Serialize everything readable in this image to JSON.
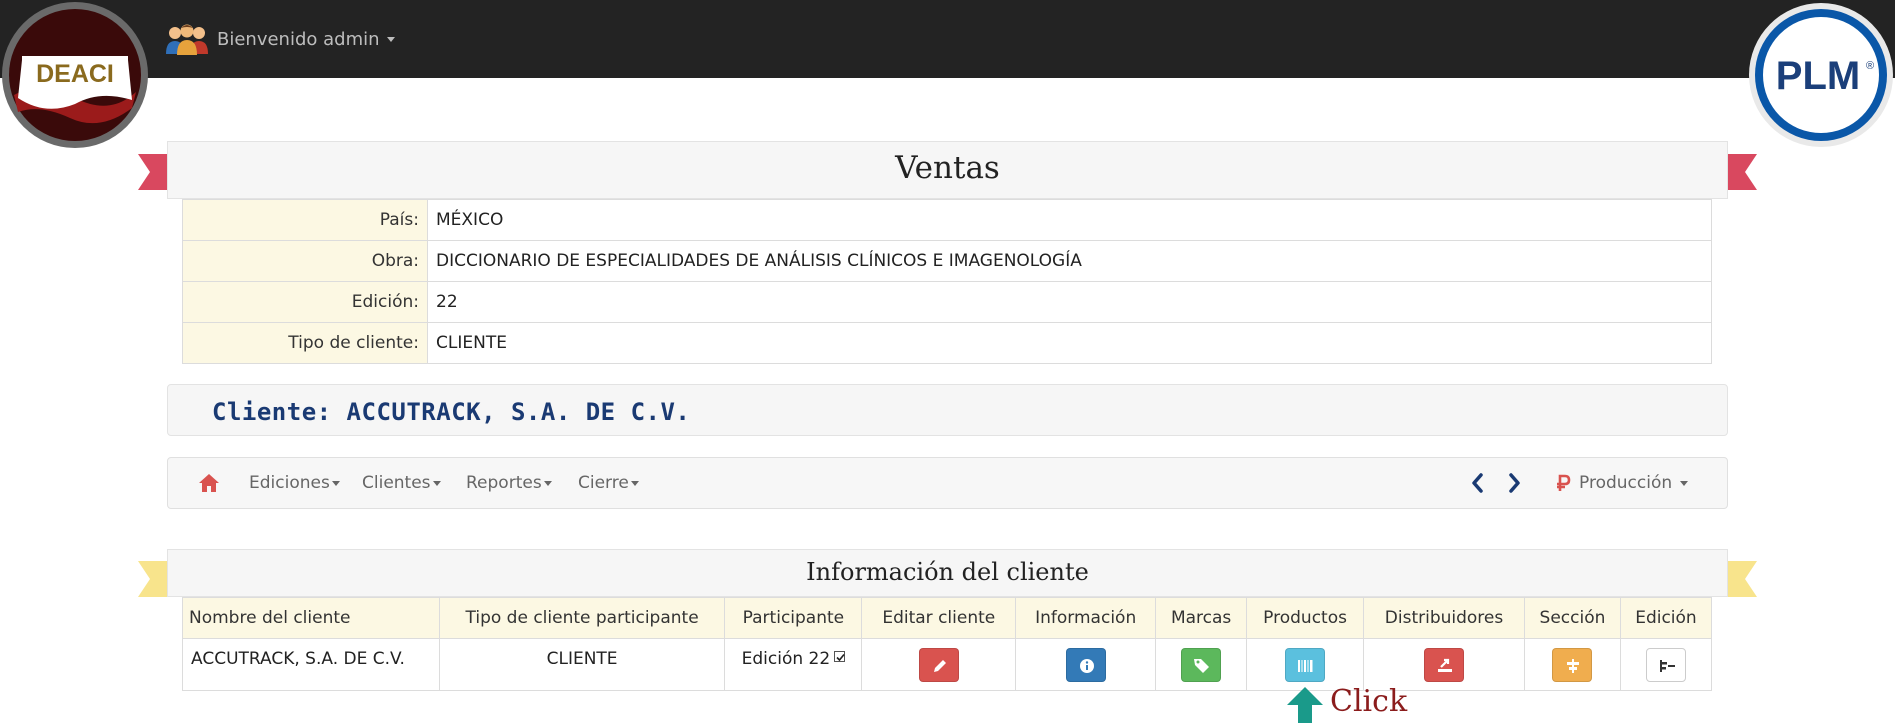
{
  "header": {
    "welcome": "Bienvenido admin",
    "logo_left_text": "DEACI",
    "logo_right_text": "PLM",
    "logo_right_mark": "®"
  },
  "page": {
    "title": "Ventas"
  },
  "info": {
    "rows": [
      {
        "label": "País:",
        "value": "MÉXICO"
      },
      {
        "label": "Obra:",
        "value": "DICCIONARIO DE ESPECIALIDADES DE ANÁLISIS CLÍNICOS E IMAGENOLOGÍA"
      },
      {
        "label": "Edición:",
        "value": "22"
      },
      {
        "label": "Tipo de cliente:",
        "value": "CLIENTE"
      }
    ]
  },
  "client": {
    "heading": "Cliente: ACCUTRACK, S.A. DE C.V."
  },
  "menu": {
    "items": [
      "Ediciones",
      "Clientes",
      "Reportes",
      "Cierre"
    ],
    "right_label": "Producción"
  },
  "section": {
    "title": "Información del cliente"
  },
  "table": {
    "headers": [
      "Nombre del cliente",
      "Tipo de cliente participante",
      "Participante",
      "Editar cliente",
      "Información",
      "Marcas",
      "Productos",
      "Distribuidores",
      "Sección",
      "Edición"
    ],
    "row": {
      "name": "ACCUTRACK, S.A. DE C.V.",
      "type": "CLIENTE",
      "participant": "Edición 22"
    }
  },
  "annotation": {
    "label": "Click"
  },
  "colors": {
    "topbar": "#232323",
    "ribbon_red": "#d9485f",
    "ribbon_yellow": "#f8e48c",
    "btn_edit": "#d9534f",
    "btn_info": "#337ab7",
    "btn_marcas": "#5cb85c",
    "btn_productos": "#5bc0de",
    "btn_distribuidores": "#d9534f",
    "btn_seccion": "#f0ad4e",
    "arrow_teal": "#1a9a8a",
    "client_blue": "#1a3a73"
  },
  "icons": [
    "users-icon",
    "home-icon",
    "chevron-left-icon",
    "chevron-right-icon",
    "ruble-icon",
    "pencil-icon",
    "info-icon",
    "tags-icon",
    "barcode-icon",
    "export-icon",
    "align-center-icon",
    "edition-icon",
    "up-arrow-icon",
    "check-icon"
  ]
}
